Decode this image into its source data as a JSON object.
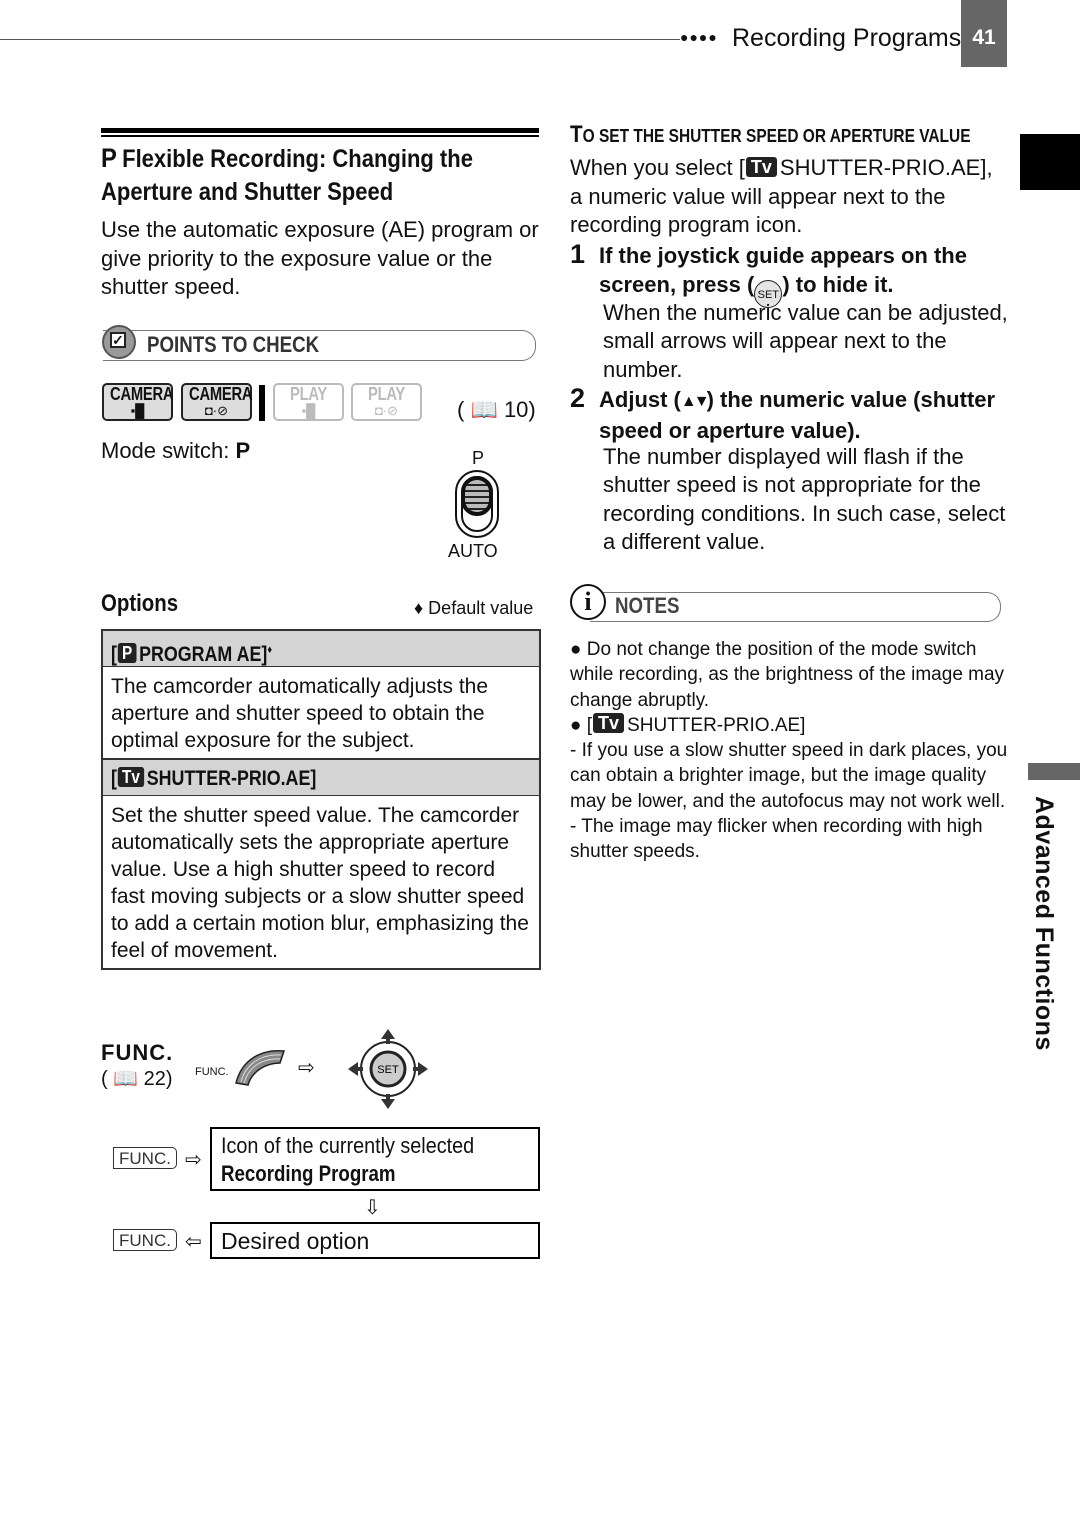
{
  "header": {
    "section_title": "Recording Programs",
    "dots": "●●●●",
    "page_number": "41"
  },
  "side_tab": {
    "label": "Advanced Functions"
  },
  "left": {
    "title_mark": "P",
    "title_line1": "Flexible Recording: Changing the",
    "title_line2": "Aperture and Shutter Speed",
    "intro": "Use the automatic exposure (AE) program or give priority to the exposure value or the shutter speed.",
    "points_to_check": {
      "icon": "checkbox-icon",
      "label": "POINTS TO CHECK"
    },
    "modes": [
      {
        "label": "CAMERA",
        "glyph": "movie-camera-icon",
        "symbol": "▪█",
        "active": true
      },
      {
        "label": "CAMERA",
        "glyph": "photo-card-icon",
        "symbol": "◘·⊘",
        "active": true
      },
      {
        "label": "PLAY",
        "glyph": "movie-camera-icon",
        "symbol": "▪█",
        "active": false
      },
      {
        "label": "PLAY",
        "glyph": "photo-card-icon",
        "symbol": "◘·⊘",
        "active": false
      }
    ],
    "mode_ref": "( 📖 10)",
    "mode_switch_label": "Mode switch: ",
    "mode_switch_value": "P",
    "switch_top_label": "P",
    "switch_bottom_label": "AUTO",
    "options_heading": "Options",
    "default_note": "♦ Default value",
    "options": [
      {
        "icon": "P",
        "label": "PROGRAM AE]",
        "default_marker": "♦",
        "description": "The camcorder automatically adjusts the aperture and shutter speed to obtain the optimal exposure for the subject."
      },
      {
        "icon": "Tv",
        "label": "SHUTTER-PRIO.AE]",
        "default_marker": "",
        "description": "Set the shutter speed value. The camcorder automatically sets the appropriate aperture value. Use a high shutter speed to record fast moving subjects or a slow shutter speed to add a certain motion blur, emphasizing the feel of movement."
      }
    ],
    "func": {
      "heading": "FUNC.",
      "ref": "( 📖 22)",
      "small_label": "FUNC.",
      "arrow": "⇨",
      "joystick_center": "SET",
      "button_label": "FUNC.",
      "step1_arrow": "⇨",
      "step1_line1": "Icon of the currently selected",
      "step1_line2": "Recording Program",
      "down_arrow": "⇩",
      "step2_arrow": "⇦",
      "step2_text": "Desired option"
    }
  },
  "right": {
    "subheading_cap1": "T",
    "subheading_rest1": "O SET THE SHUTTER SPEED OR APERTURE VALUE",
    "intro_pre": "When you select [",
    "intro_icon": "Tv",
    "intro_post": "SHUTTER-PRIO.AE], a numeric value will appear next to the recording program icon.",
    "steps": [
      {
        "number": "1",
        "heading_pre": "If the joystick guide appears on the screen, press (",
        "heading_icon": "SET",
        "heading_post": ") to hide it.",
        "body": "When the numeric value can be adjusted, small arrows will appear next to the number."
      },
      {
        "number": "2",
        "heading_pre": "Adjust (",
        "heading_icon": "▲▼",
        "heading_post": ") the numeric value (shutter speed or aperture value).",
        "body": "The number displayed will flash if the shutter speed is not appropriate for the recording conditions. In such case, select a different value."
      }
    ],
    "notes": {
      "icon": "i",
      "label": "NOTES",
      "items": [
        "● Do not change the position of the mode switch while recording, as the brightness of the image may change abruptly."
      ],
      "tv_item_pre": "● [",
      "tv_item_icon": "Tv",
      "tv_item_post": "SHUTTER-PRIO.AE]",
      "sub_items": [
        "-  If you use a slow shutter speed in dark places, you can obtain a brighter image, but the image quality may be lower, and the autofocus may not work well.",
        "-  The image may flicker when recording with high shutter speeds."
      ]
    }
  }
}
